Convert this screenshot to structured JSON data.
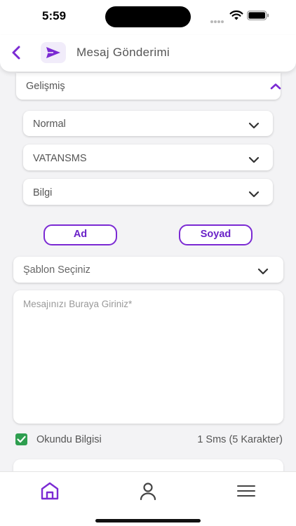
{
  "status_bar": {
    "time": "5:59"
  },
  "header": {
    "title": "Mesaj Gönderimi",
    "back_icon": "chevron-left-icon",
    "send_icon": "send-icon",
    "accent_color": "#7b2ad3"
  },
  "advanced": {
    "label": "Gelişmiş",
    "expanded": true
  },
  "selects": {
    "priority": "Normal",
    "sender": "VATANSMS",
    "type": "Bilgi"
  },
  "variable_buttons": {
    "first_name": "Ad",
    "last_name": "Soyad"
  },
  "template_select": {
    "placeholder": "Şablon Seçiniz"
  },
  "message": {
    "placeholder": "Mesajınızı Buraya Giriniz*",
    "value": ""
  },
  "read_receipt": {
    "label": "Okundu Bilgisi",
    "checked": true,
    "check_color": "#2e9e4f"
  },
  "sms_count": "1 Sms (5 Karakter)",
  "tab_bar": {
    "tabs": [
      {
        "icon": "home-icon",
        "active": true
      },
      {
        "icon": "user-icon",
        "active": false
      },
      {
        "icon": "menu-icon",
        "active": false
      }
    ]
  }
}
